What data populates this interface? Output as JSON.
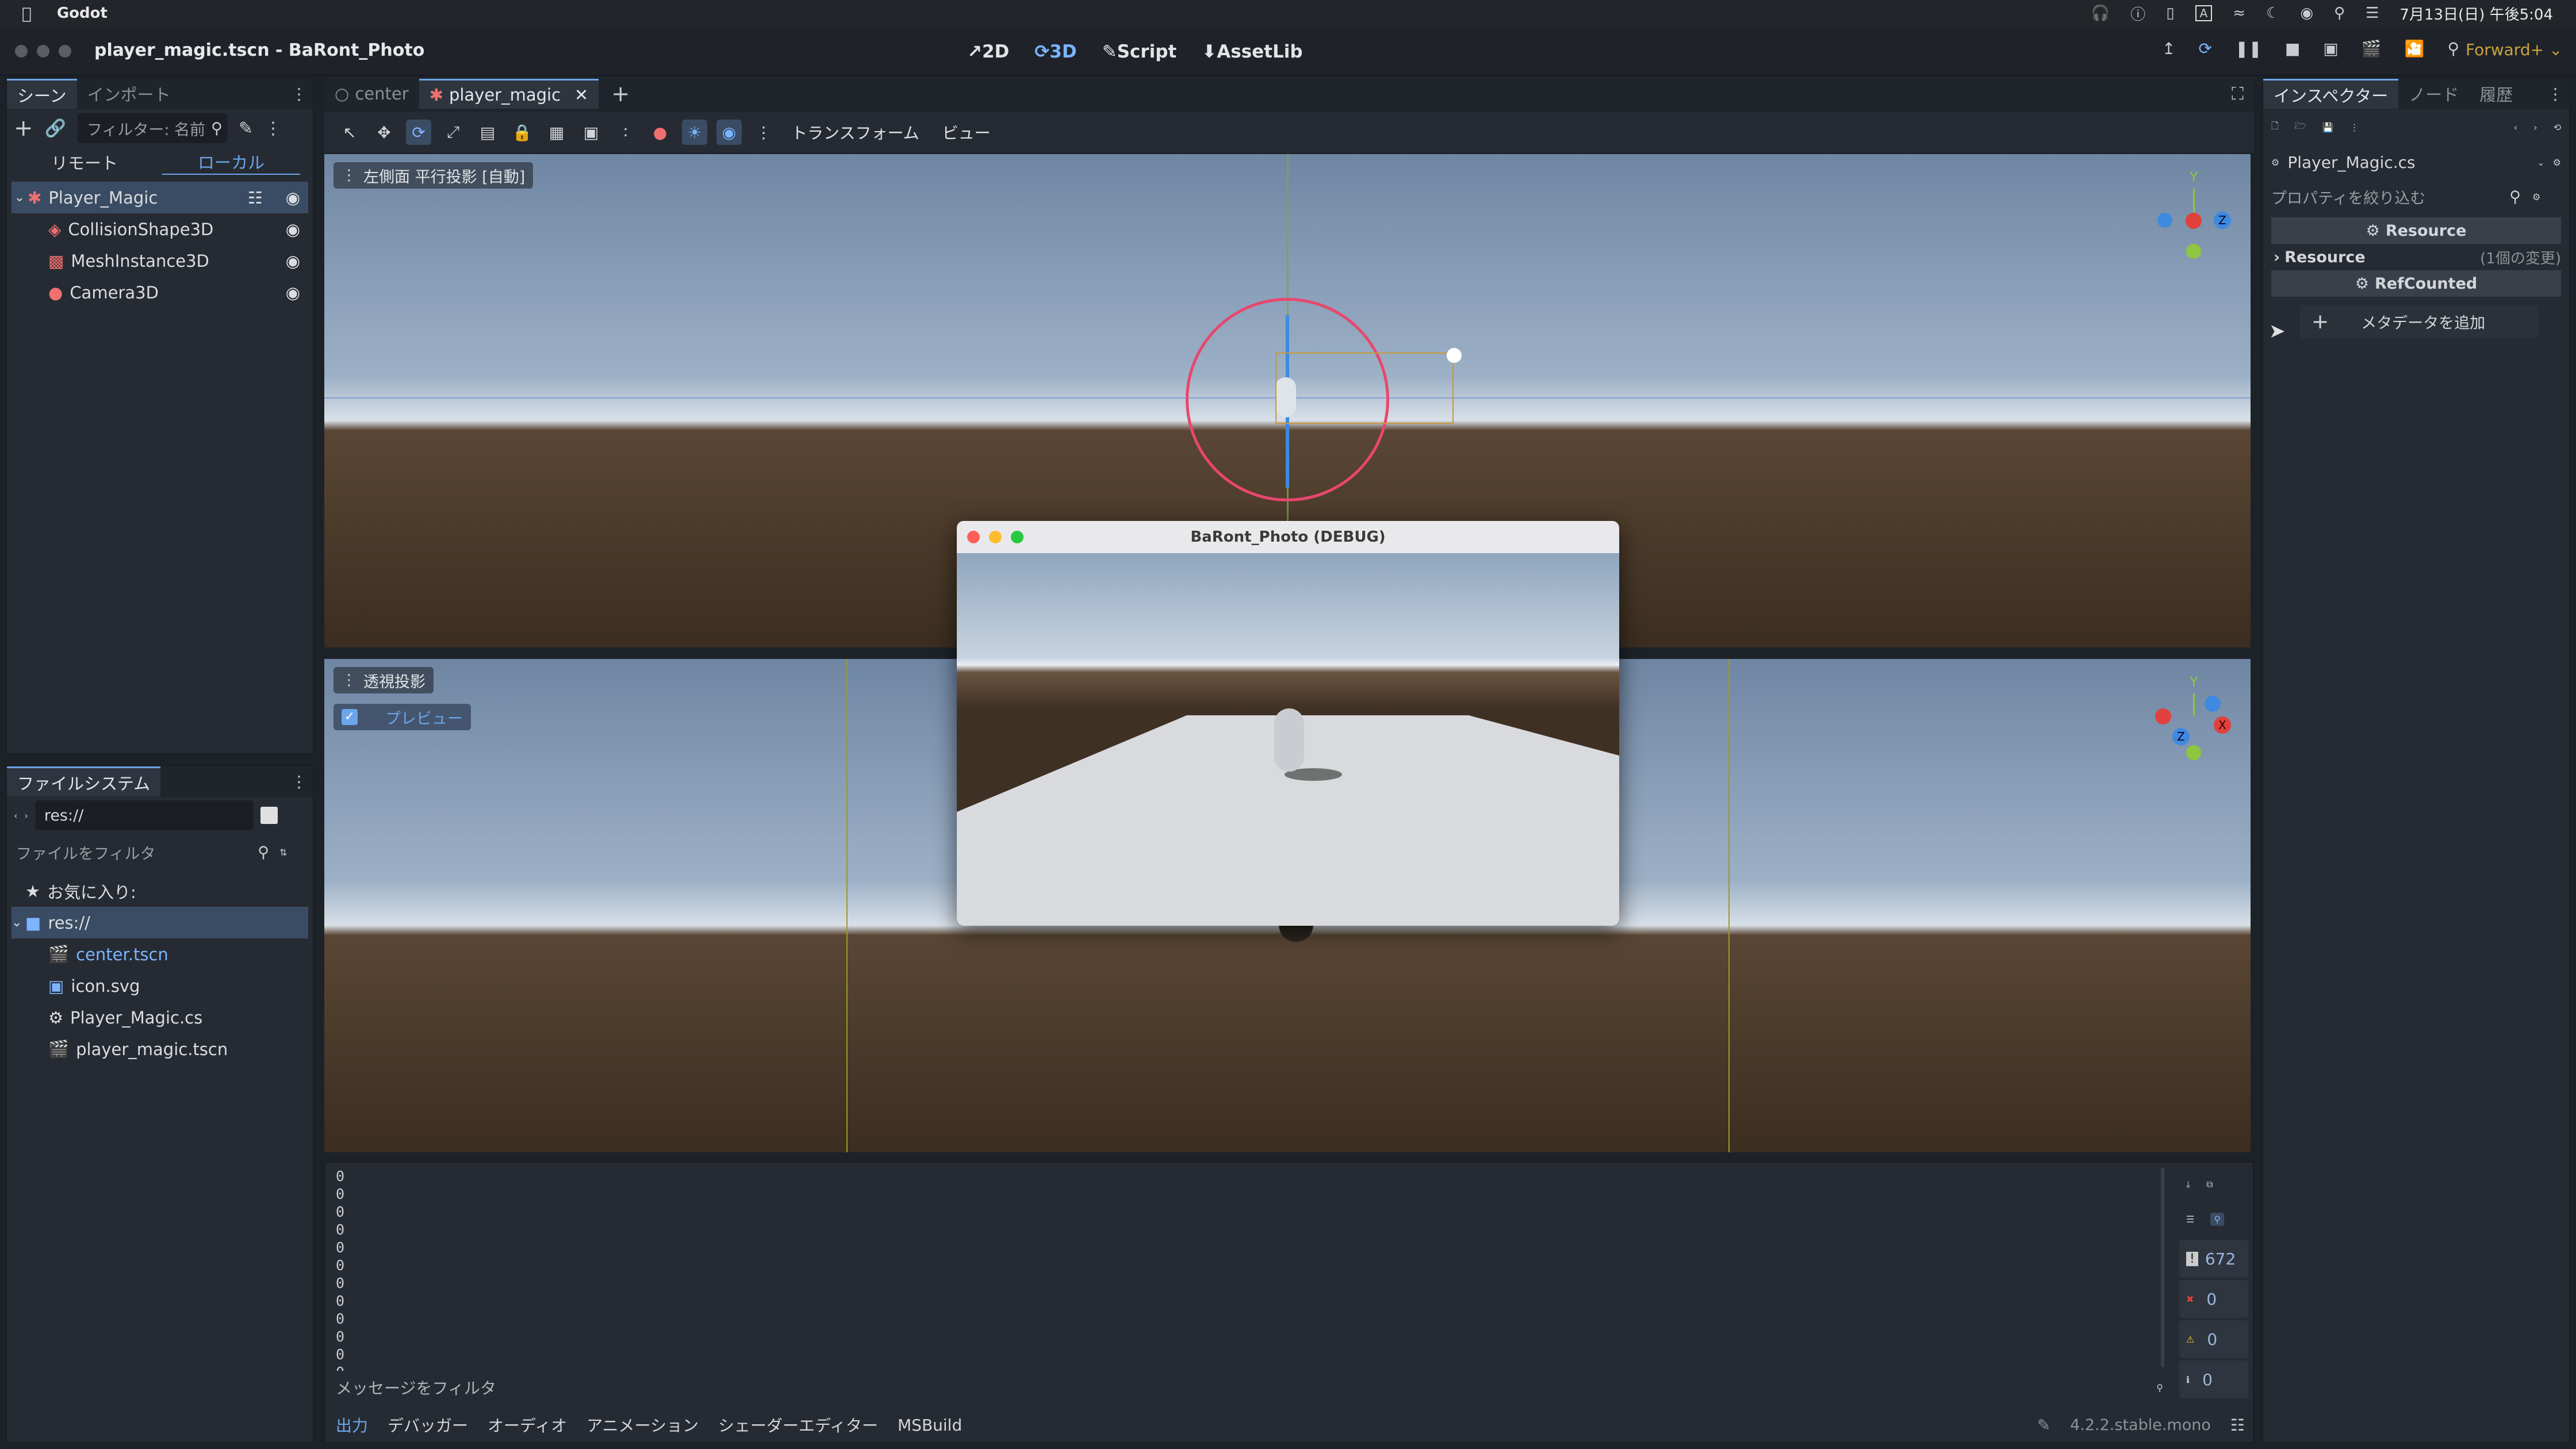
{
  "menubar": {
    "app": "Godot",
    "date": "7月13日(日) 午後5:04"
  },
  "titlebar": {
    "title": "player_magic.tscn - BaRont_Photo",
    "modes": [
      "2D",
      "3D",
      "Script",
      "AssetLib"
    ],
    "renderer": "Forward+"
  },
  "scene_panel": {
    "tabs": [
      "シーン",
      "インポート"
    ],
    "filter_placeholder": "フィルター: 名前",
    "remote": "リモート",
    "local": "ローカル",
    "nodes": [
      "Player_Magic",
      "CollisionShape3D",
      "MeshInstance3D",
      "Camera3D"
    ]
  },
  "filesystem": {
    "title": "ファイルシステム",
    "path": "res://",
    "filter_placeholder": "ファイルをフィルタ",
    "favorites": "お気に入り:",
    "root": "res://",
    "files": [
      "center.tscn",
      "icon.svg",
      "Player_Magic.cs",
      "player_magic.tscn"
    ]
  },
  "editor_tabs": [
    "center",
    "player_magic"
  ],
  "viewport_toolbar": {
    "transform": "トランスフォーム",
    "view": "ビュー"
  },
  "viewport_top": {
    "label": "左側面 平行投影 [自動]"
  },
  "viewport_bottom": {
    "label": "透視投影",
    "preview": "プレビュー"
  },
  "gizmo": {
    "x": "X",
    "y": "Y",
    "z": "Z"
  },
  "debug_window": {
    "title": "BaRont_Photo (DEBUG)"
  },
  "output": {
    "lines": [
      "0",
      "0",
      "0",
      "0",
      "0",
      "0",
      "0",
      "0",
      "0",
      "0",
      "0",
      "0"
    ],
    "filter_placeholder": "メッセージをフィルタ",
    "counts": {
      "messages": "672",
      "errors": "0",
      "warnings": "0",
      "info": "0"
    },
    "tabs": [
      "出力",
      "デバッガー",
      "オーディオ",
      "アニメーション",
      "シェーダーエディター",
      "MSBuild"
    ],
    "version": "4.2.2.stable.mono"
  },
  "inspector": {
    "tabs": [
      "インスペクター",
      "ノード",
      "履歴"
    ],
    "resource_file": "Player_Magic.cs",
    "filter_placeholder": "プロパティを絞り込む",
    "section1": "Resource",
    "row_label": "Resource",
    "row_value": "(1個の変更)",
    "section2": "RefCounted",
    "add_meta": "メタデータを追加"
  },
  "colors": {
    "accent": "#6ba6e9",
    "x_axis": "#e0413c",
    "y_axis": "#8ec63f",
    "z_axis": "#3d8ae0",
    "selection": "#3a4c63"
  }
}
